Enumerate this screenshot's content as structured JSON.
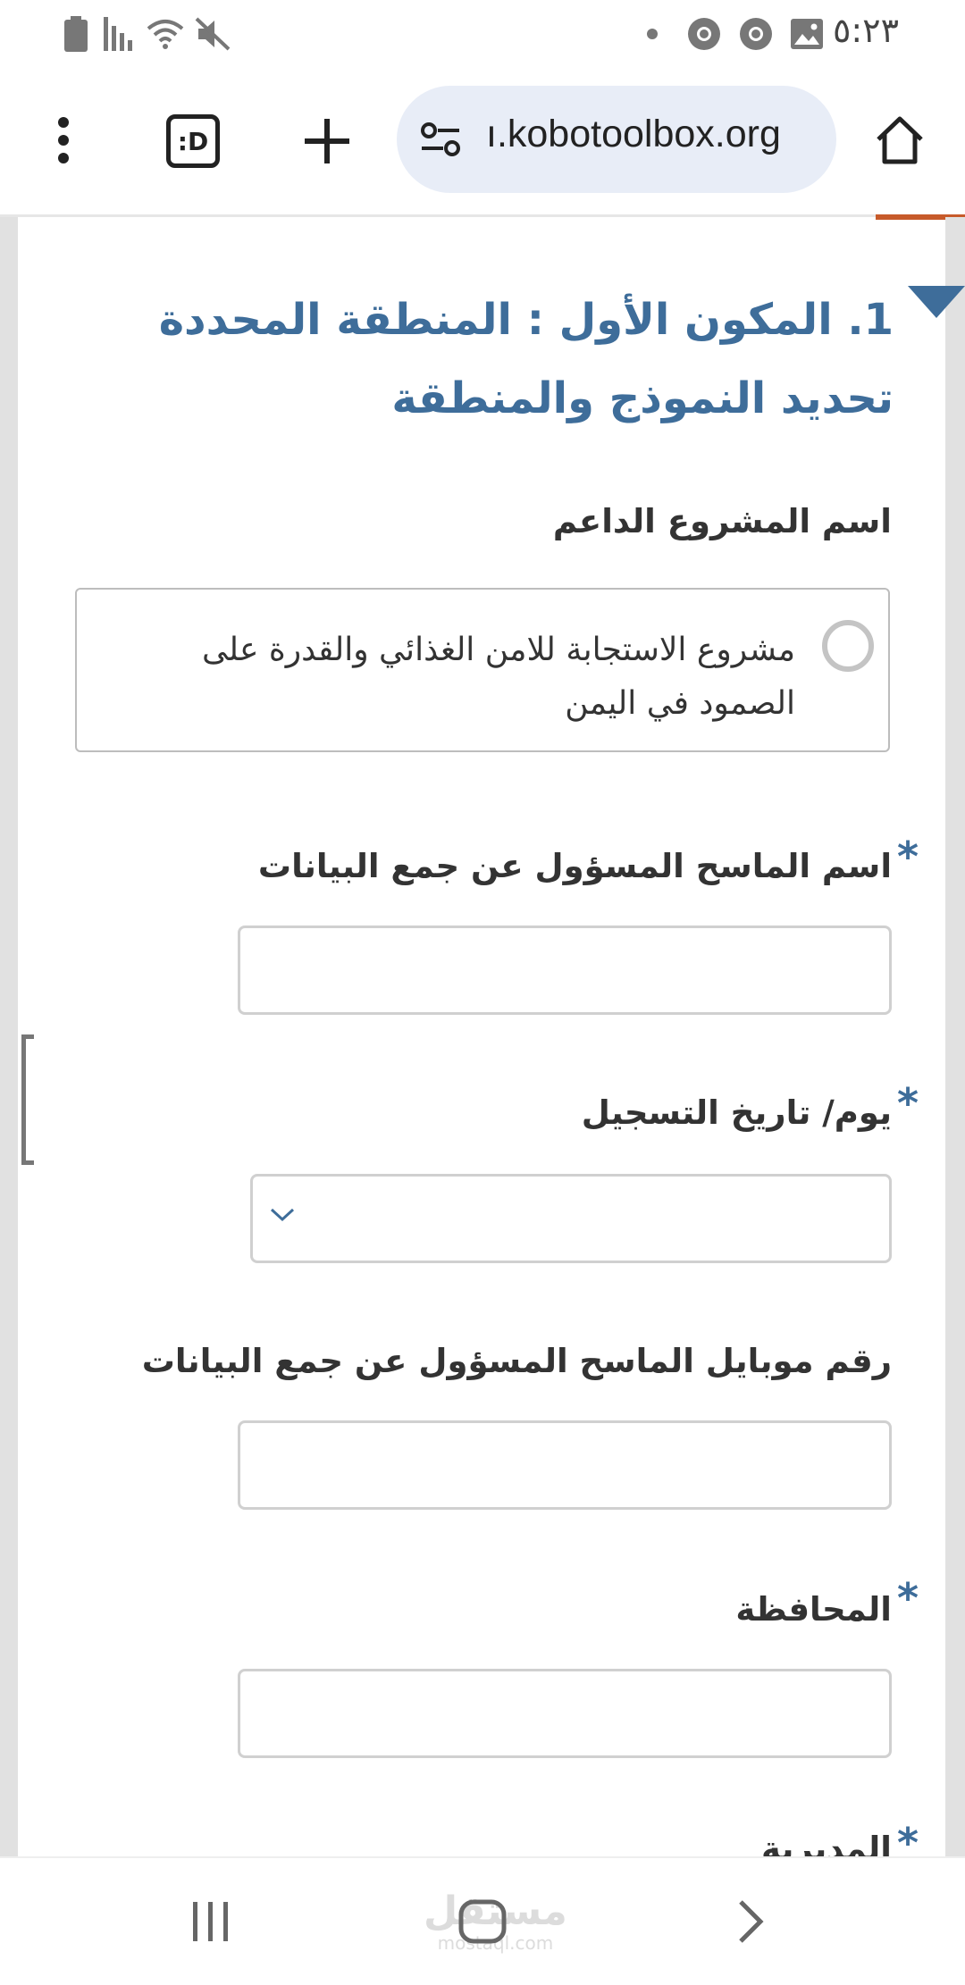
{
  "status_bar": {
    "time": "٥:٢٣",
    "left_icons": [
      "battery-icon",
      "signal-icon",
      "wifi-icon",
      "mute-icon"
    ],
    "right_icons": [
      "notification-dot-icon",
      "chrome-icon",
      "chrome-icon",
      "gallery-icon"
    ]
  },
  "browser": {
    "url": "ı.kobotoolbox.org",
    "tab_switcher_label": ":D",
    "icons": [
      "menu-dots-icon",
      "tab-switcher-icon",
      "new-tab-icon",
      "site-settings-icon",
      "home-icon"
    ]
  },
  "form": {
    "group_title": "1. المكون الأول : المنطقة المحددة تحديد النموذج والمنطقة",
    "q1": {
      "label": "اسم المشروع الداعم",
      "option": "مشروع الاستجابة للامن الغذائي والقدرة على الصمود في اليمن"
    },
    "q2": {
      "label": "اسم الماسح المسؤول عن جمع البيانات",
      "required": "*",
      "value": ""
    },
    "q3": {
      "label": "يوم/ تاريخ التسجيل",
      "required": "*",
      "value": ""
    },
    "q4": {
      "label": "رقم موبايل الماسح المسؤول عن جمع البيانات",
      "value": ""
    },
    "q5": {
      "label": "المحافظة",
      "required": "*",
      "value": ""
    },
    "q6": {
      "label": "المديرية",
      "required": "*"
    }
  },
  "nav_bar": {
    "watermark": "مستقل",
    "watermark_sub": "mostaql.com"
  },
  "colors": {
    "accent_blue": "#3e6d9a",
    "tab_indicator": "#c75a2a",
    "url_pill_bg": "#e8edf7"
  }
}
